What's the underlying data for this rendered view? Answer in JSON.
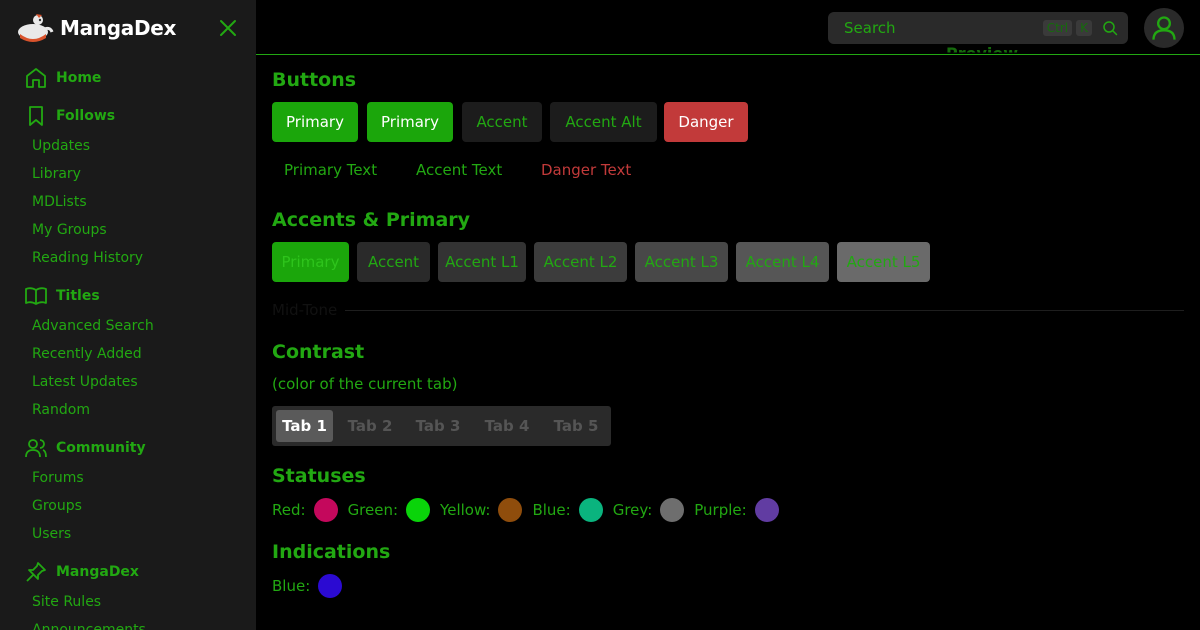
{
  "brand": {
    "name": "MangaDex"
  },
  "sidebar": {
    "groups": [
      {
        "title": "Home",
        "icon": "home-icon",
        "items": []
      },
      {
        "title": "Follows",
        "icon": "bookmark-icon",
        "items": [
          "Updates",
          "Library",
          "MDLists",
          "My Groups",
          "Reading History"
        ]
      },
      {
        "title": "Titles",
        "icon": "book-open-icon",
        "items": [
          "Advanced Search",
          "Recently Added",
          "Latest Updates",
          "Random"
        ]
      },
      {
        "title": "Community",
        "icon": "users-icon",
        "items": [
          "Forums",
          "Groups",
          "Users"
        ]
      },
      {
        "title": "MangaDex",
        "icon": "pin-icon",
        "items": [
          "Site Rules",
          "Announcements"
        ]
      }
    ]
  },
  "header": {
    "search_placeholder": "Search",
    "shortcut_key1": "Ctrl",
    "shortcut_key2": "K",
    "peek_title": "Preview"
  },
  "sections": {
    "buttons": {
      "title": "Buttons",
      "filled": [
        "Primary",
        "Primary",
        "Accent",
        "Accent Alt",
        "Danger"
      ],
      "text": [
        "Primary Text",
        "Accent Text",
        "Danger Text"
      ]
    },
    "accents": {
      "title": "Accents & Primary",
      "items": [
        "Primary",
        "Accent",
        "Accent L1",
        "Accent L2",
        "Accent L3",
        "Accent L4",
        "Accent L5"
      ],
      "midtone": "Mid-Tone"
    },
    "contrast": {
      "title": "Contrast",
      "subtitle": "(color of the current tab)",
      "tabs": [
        "Tab 1",
        "Tab 2",
        "Tab 3",
        "Tab 4",
        "Tab 5"
      ],
      "active_tab": "Tab 1"
    },
    "statuses": {
      "title": "Statuses",
      "items": [
        {
          "label": "Red:",
          "color": "#c4085c"
        },
        {
          "label": "Green:",
          "color": "#0ad40a"
        },
        {
          "label": "Yellow:",
          "color": "#8f4d0c"
        },
        {
          "label": "Blue:",
          "color": "#0ab47e"
        },
        {
          "label": "Grey:",
          "color": "#6e6e6e"
        },
        {
          "label": "Purple:",
          "color": "#613ca2"
        }
      ]
    },
    "indications": {
      "title": "Indications",
      "items": [
        {
          "label": "Blue:",
          "color": "#2b0ad2"
        }
      ]
    }
  },
  "colors": {
    "primary": "#22a812",
    "primary_bg": "#1ba60b",
    "danger": "#c23a3a",
    "danger_text": "#c23a3a",
    "accent_bg": "#2a2a2a",
    "accent_l1": "#333333",
    "accent_l2": "#3c3c3c",
    "accent_l3": "#484848",
    "accent_l4": "#565656",
    "accent_l5": "#6a6a6a"
  }
}
